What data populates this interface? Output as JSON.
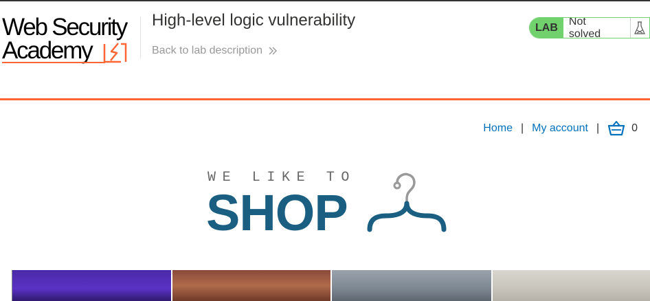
{
  "academy": {
    "logo_line1": "Web Security",
    "logo_line2": "Academy",
    "lab_title": "High-level logic vulnerability",
    "back_link": "Back to lab description",
    "status_tag": "LAB",
    "status_text": "Not solved",
    "icons": {
      "back": "double-chevron-right-icon",
      "status": "flask-icon"
    },
    "colors": {
      "accent": "#ff6633",
      "status_green": "#70d16d"
    }
  },
  "shop_nav": {
    "home": "Home",
    "separator": "|",
    "my_account": "My account",
    "cart_count": "0",
    "icons": {
      "cart": "basket-icon"
    },
    "link_color": "#0071bc"
  },
  "shop_logo": {
    "tagline": "WE LIKE TO",
    "word": "SHOP",
    "icon": "hanger-icon",
    "color": "#1a5f82"
  },
  "products": [
    {
      "id": "product-1"
    },
    {
      "id": "product-2"
    },
    {
      "id": "product-3"
    },
    {
      "id": "product-4"
    }
  ]
}
